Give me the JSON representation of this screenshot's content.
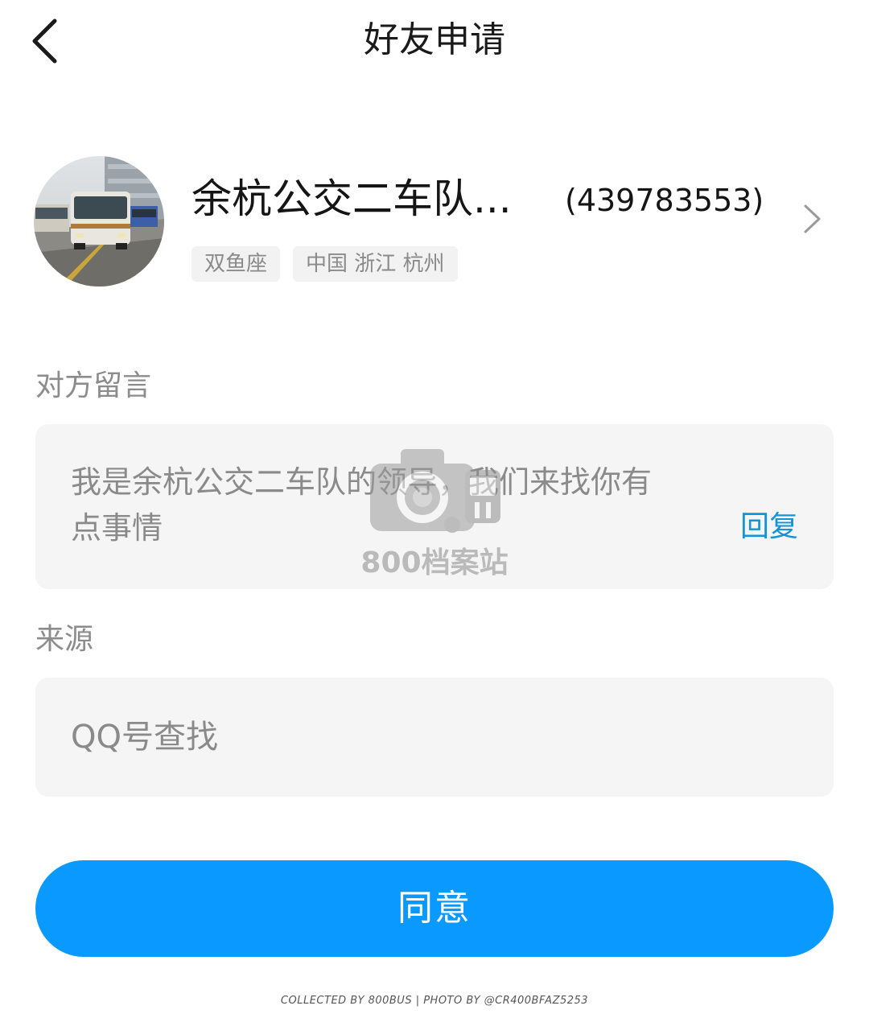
{
  "header": {
    "title": "好友申请",
    "back_icon": "chevron-left-icon"
  },
  "profile": {
    "nickname": "余杭公交二车队...",
    "qq_number": "(439783553)",
    "tags": [
      "双鱼座",
      "中国 浙江 杭州"
    ],
    "avatar_icon": "bus-photo-avatar",
    "arrow_icon": "chevron-right-icon"
  },
  "message_section": {
    "label": "对方留言",
    "text": "我是余杭公交二车队的领导，我们来找你有点事情",
    "reply_label": "回复"
  },
  "source_section": {
    "label": "来源",
    "value": "QQ号查找"
  },
  "agree_button": {
    "label": "同意",
    "color": "#0a99ff"
  },
  "watermark": {
    "text": "800档案站",
    "icon": "camera-bus-icon"
  },
  "footer": {
    "credit": "COLLECTED BY 800BUS | PHOTO BY @CR400BFAZ5253"
  },
  "colors": {
    "accent": "#0a99ff",
    "link": "#1294d6",
    "card_bg": "#f5f5f5",
    "muted_text": "#8a8a8a"
  }
}
